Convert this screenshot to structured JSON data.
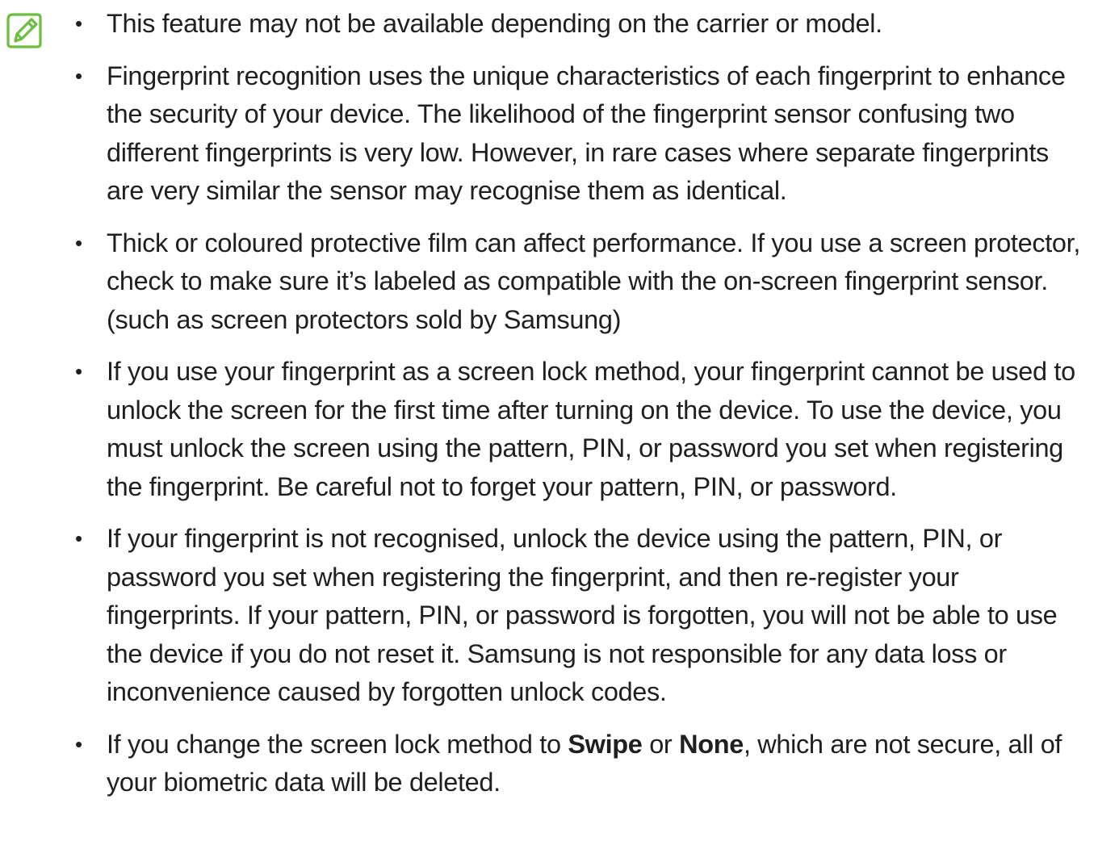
{
  "note": {
    "icon": "note-pencil-icon",
    "icon_color": "#6bbf3e",
    "bullet_glyph": "•",
    "items": [
      {
        "text": "This feature may not be available depending on the carrier or model."
      },
      {
        "text": "Fingerprint recognition uses the unique characteristics of each fingerprint to enhance the security of your device. The likelihood of the fingerprint sensor confusing two different fingerprints is very low. However, in rare cases where separate fingerprints are very similar the sensor may recognise them as identical."
      },
      {
        "text": "Thick or coloured protective film can affect performance. If you use a screen protector, check to make sure it’s labeled as compatible with the on-screen fingerprint sensor. (such as screen protectors sold by Samsung)"
      },
      {
        "text": "If you use your fingerprint as a screen lock method, your fingerprint cannot be used to unlock the screen for the first time after turning on the device. To use the device, you must unlock the screen using the pattern, PIN, or password you set when registering the fingerprint. Be careful not to forget your pattern, PIN, or password."
      },
      {
        "text": "If your fingerprint is not recognised, unlock the device using the pattern, PIN, or password you set when registering the fingerprint, and then re-register your fingerprints. If your pattern, PIN, or password is forgotten, you will not be able to use the device if you do not reset it. Samsung is not responsible for any data loss or inconvenience caused by forgotten unlock codes."
      },
      {
        "text_before": "If you change the screen lock method to ",
        "bold_1": "Swipe",
        "text_middle": " or ",
        "bold_2": "None",
        "text_after": ", which are not secure, all of your biometric data will be deleted."
      }
    ]
  }
}
